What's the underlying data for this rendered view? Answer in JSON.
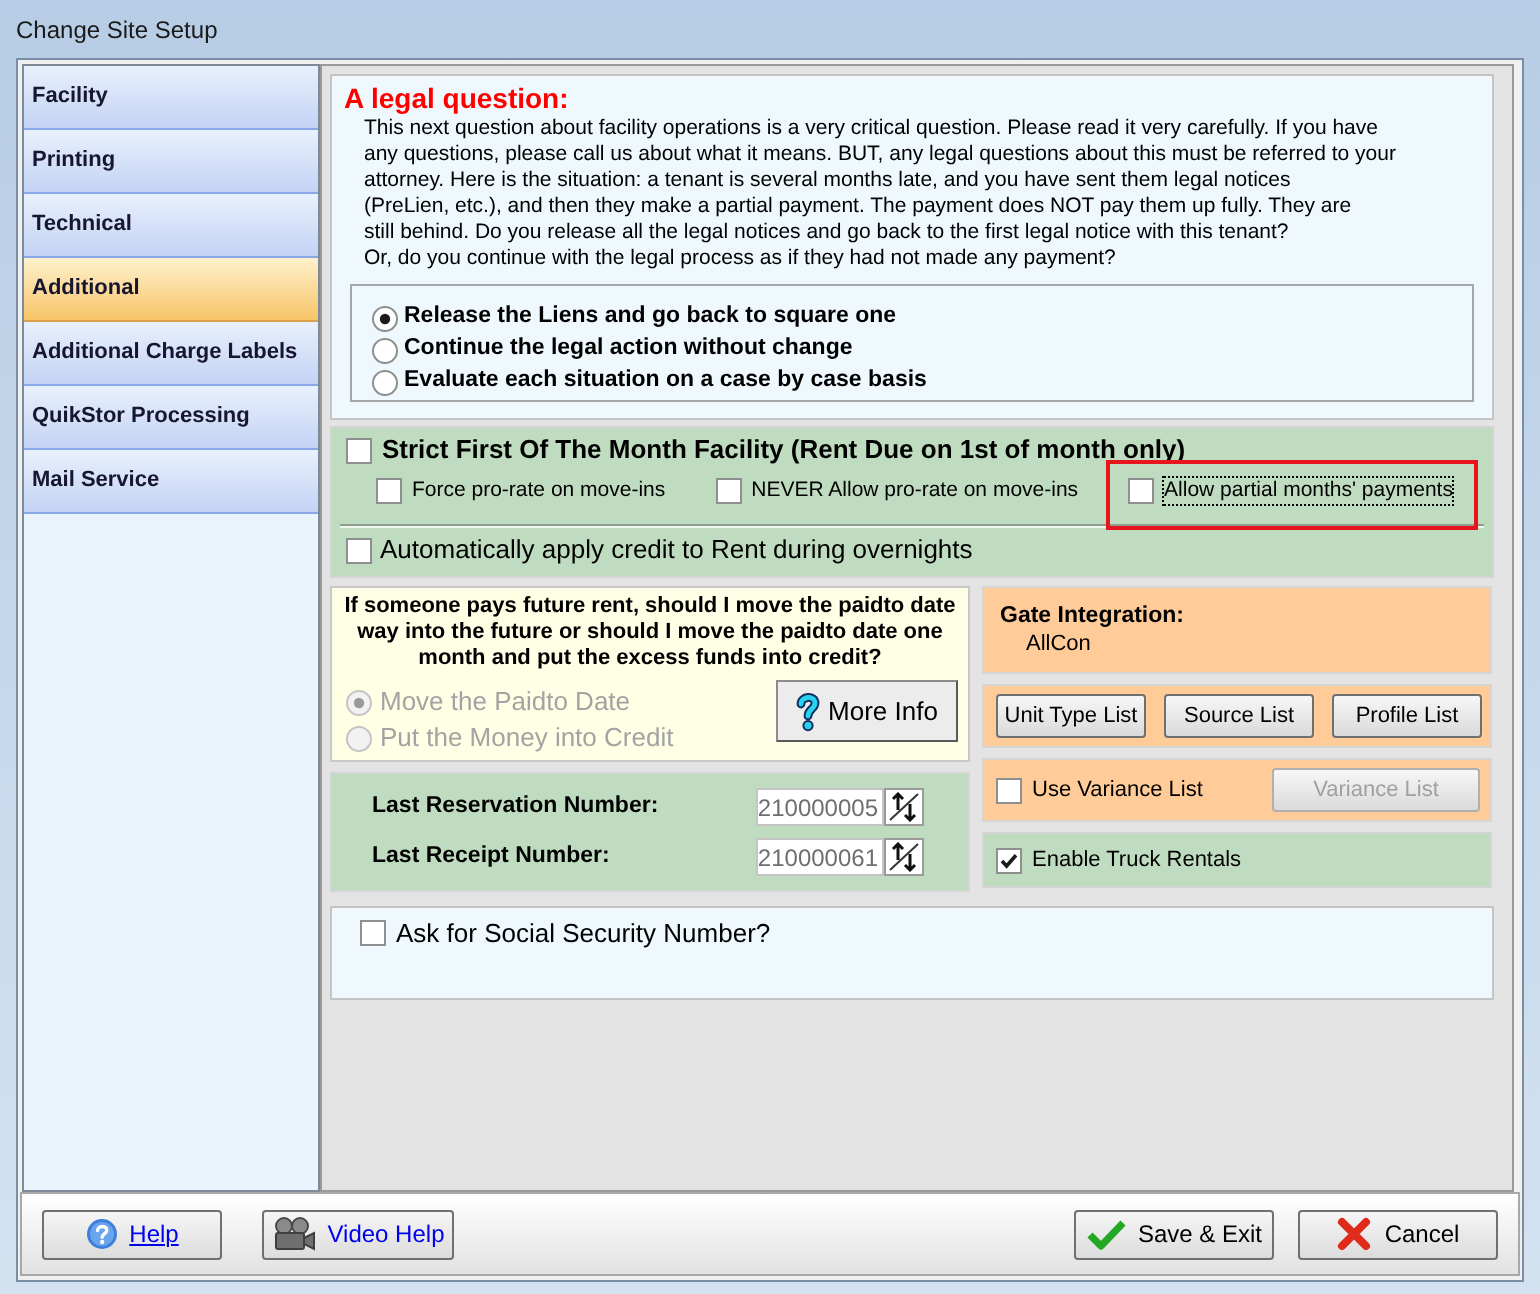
{
  "window": {
    "title": "Change Site Setup"
  },
  "sidebar": {
    "items": [
      {
        "label": "Facility",
        "selected": false
      },
      {
        "label": "Printing",
        "selected": false
      },
      {
        "label": "Technical",
        "selected": false
      },
      {
        "label": "Additional",
        "selected": true
      },
      {
        "label": "Additional Charge Labels",
        "selected": false
      },
      {
        "label": "QuikStor Processing",
        "selected": false
      },
      {
        "label": "Mail Service",
        "selected": false
      }
    ]
  },
  "legal_question": {
    "title": "A legal question:",
    "text_lines": [
      "This next question about facility operations is a very critical question. Please read it very carefully. If you have",
      "any questions, please call us about what it means. BUT, any legal questions about this must be referred to your",
      "attorney. Here is the situation: a tenant is several months late, and you have sent them legal notices",
      "(PreLien, etc.), and then they make a partial payment. The payment does NOT pay them up fully. They are",
      "still behind. Do you release all the legal notices and go back to the first legal notice with this tenant?",
      "Or, do you continue with the legal process as if they had not made any payment?"
    ],
    "options": [
      {
        "label": "Release the Liens and go back to square one",
        "selected": true
      },
      {
        "label": "Continue the legal action without change",
        "selected": false
      },
      {
        "label": "Evaluate each situation on a case by case basis",
        "selected": false
      }
    ]
  },
  "first_of_month": {
    "strict": {
      "label": "Strict First Of The Month Facility (Rent Due on 1st of month only)",
      "checked": false
    },
    "options": [
      {
        "label": "Force pro-rate on move-ins",
        "checked": false,
        "focused": false,
        "highlighted": false
      },
      {
        "label": "NEVER Allow pro-rate on move-ins",
        "checked": false,
        "focused": false,
        "highlighted": false
      },
      {
        "label": "Allow partial months' payments",
        "checked": false,
        "focused": true,
        "highlighted": true
      }
    ],
    "auto_credit": {
      "label": "Automatically apply credit to Rent during overnights",
      "checked": false
    }
  },
  "future_rent": {
    "question": "If someone pays future rent, should I move the paidto date way into the future or should I move the paidto date one month and put the excess funds into credit?",
    "options": [
      {
        "label": "Move the Paidto Date",
        "selected": true,
        "disabled": true
      },
      {
        "label": "Put the Money into Credit",
        "selected": false,
        "disabled": true
      }
    ],
    "more_info_button": "More Info"
  },
  "numbers": [
    {
      "label": "Last Reservation Number:",
      "value": "210000005"
    },
    {
      "label": "Last Receipt Number:",
      "value": "210000061"
    }
  ],
  "gate": {
    "label": "Gate Integration:",
    "value": "AllCon"
  },
  "list_buttons": [
    "Unit Type List",
    "Source List",
    "Profile List"
  ],
  "variance": {
    "checkbox": {
      "label": "Use Variance List",
      "checked": false
    },
    "button": {
      "label": "Variance List",
      "disabled": true
    }
  },
  "truck_rentals": {
    "label": "Enable Truck Rentals",
    "checked": true
  },
  "ssn": {
    "label": "Ask for Social Security Number?",
    "checked": false
  },
  "footer": {
    "left_buttons": [
      {
        "label": "Help",
        "kind": "help"
      },
      {
        "label": "Video Help",
        "kind": "video"
      }
    ],
    "right_buttons": [
      {
        "label": "Save & Exit",
        "kind": "save"
      },
      {
        "label": "Cancel",
        "kind": "cancel"
      }
    ]
  }
}
